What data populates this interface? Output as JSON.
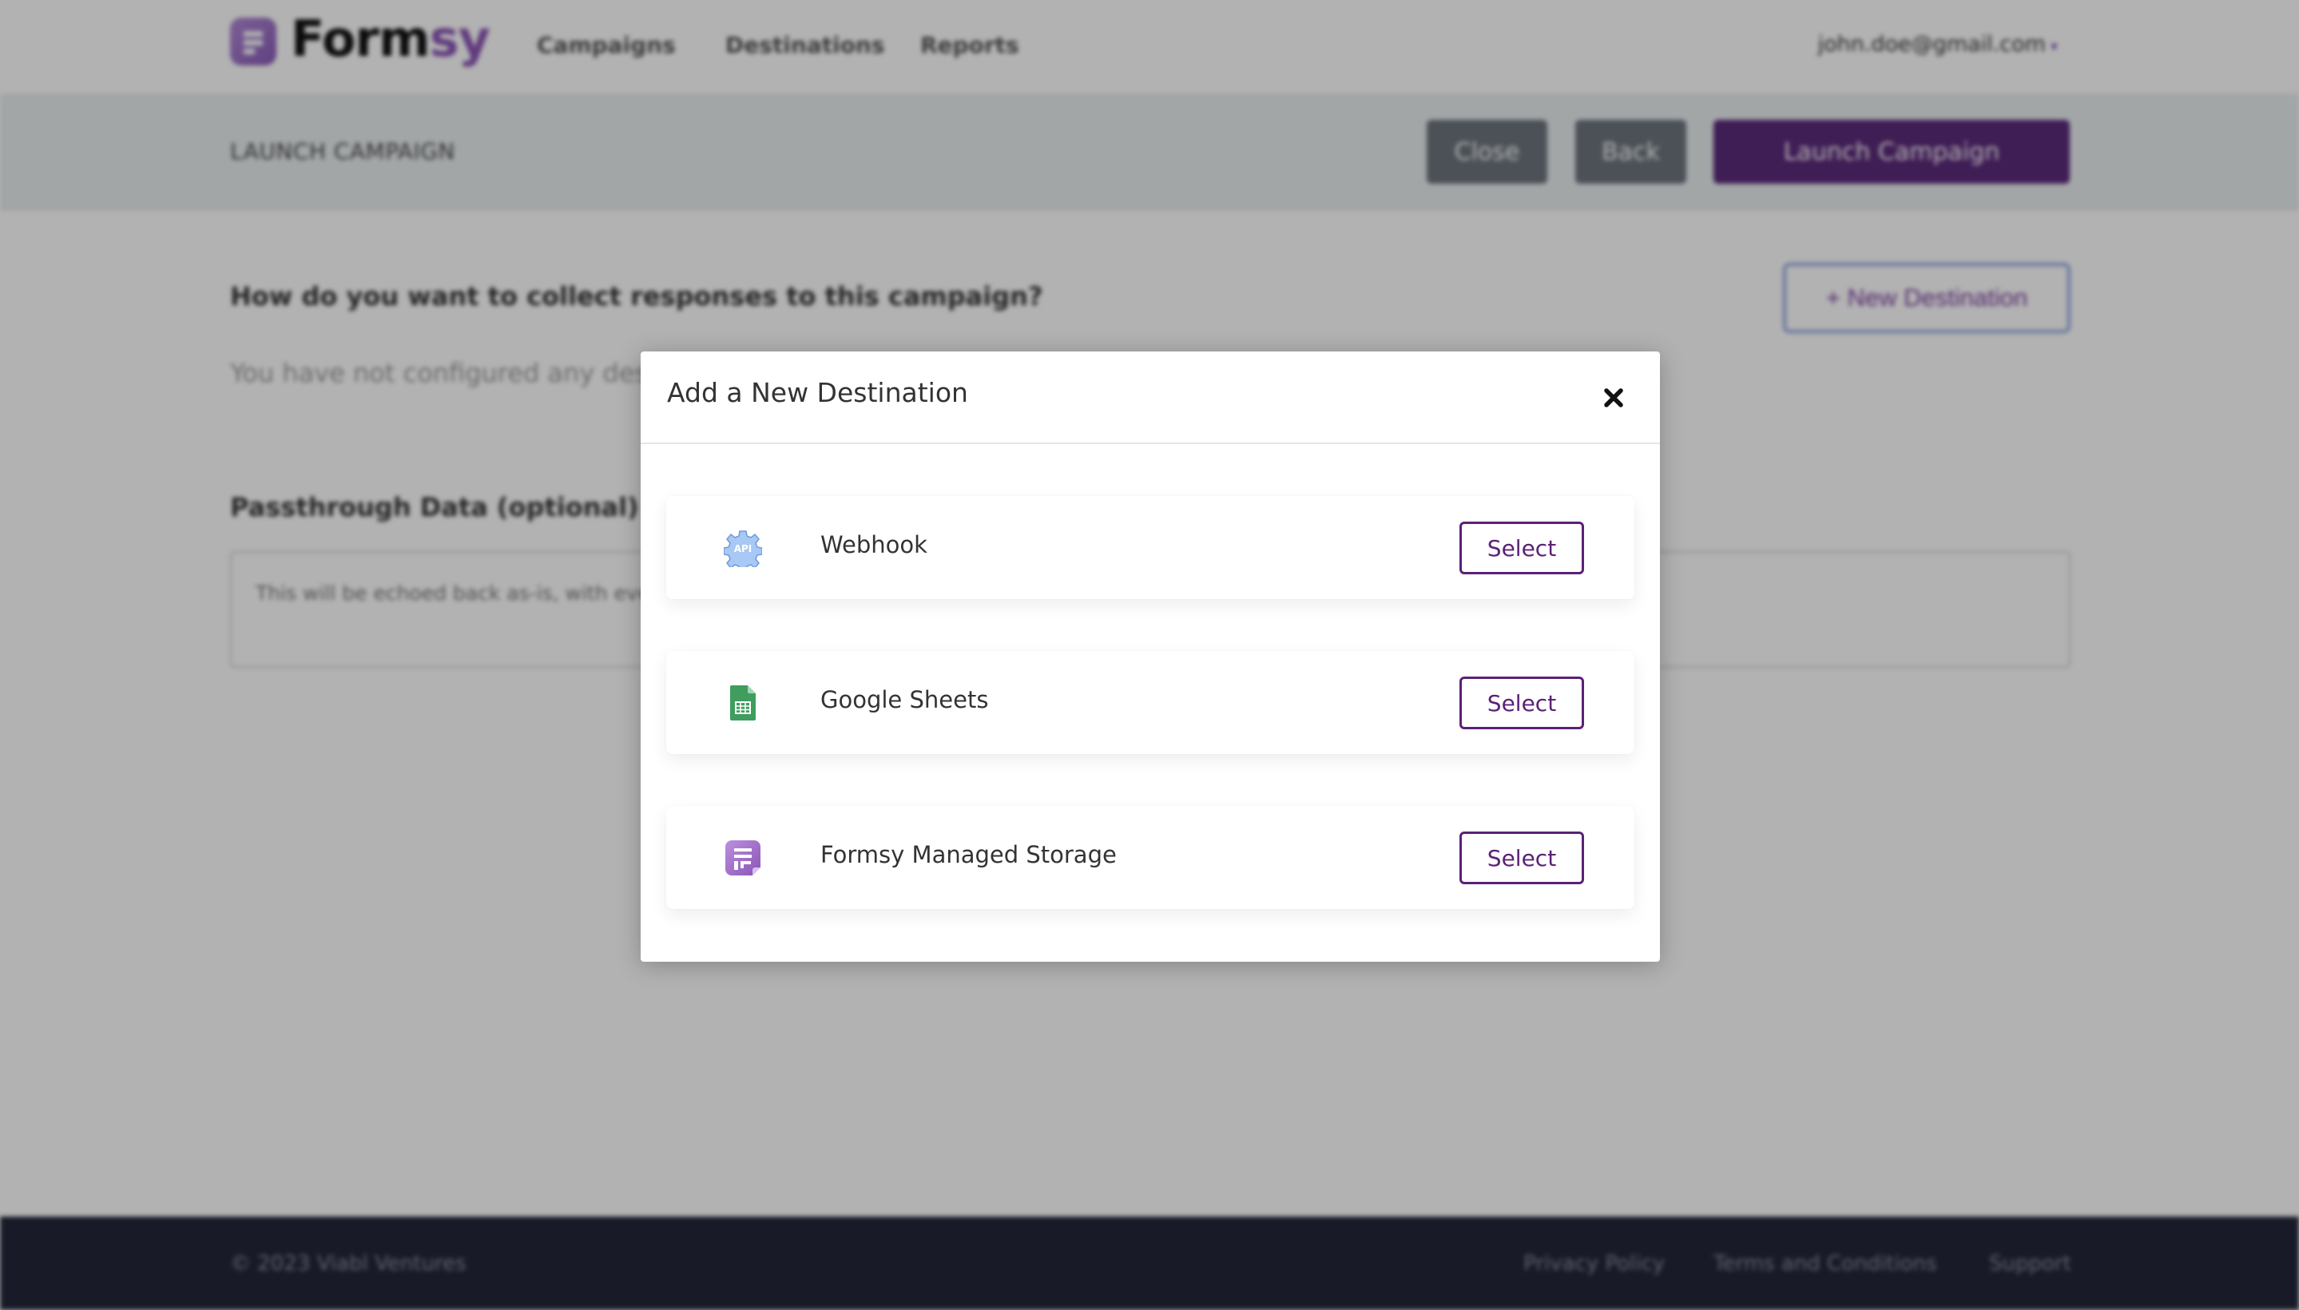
{
  "app": {
    "brand_main": "Form",
    "brand_accent": "sy",
    "brand_color": "#8b55b6"
  },
  "nav": {
    "items": [
      {
        "label": "Campaigns"
      },
      {
        "label": "Destinations"
      },
      {
        "label": "Reports"
      }
    ],
    "user_email": "john.doe@gmail.com",
    "user_caret": "▾"
  },
  "subbar": {
    "title": "LAUNCH CAMPAIGN",
    "close_label": "Close",
    "back_label": "Back",
    "launch_label": "Launch Campaign"
  },
  "main": {
    "question": "How do you want to collect responses to this campaign?",
    "new_destination_label": "+ New Destination",
    "empty_note": "You have not configured any destinations yet.",
    "passthrough_label": "Passthrough Data (optional)",
    "passthrough_placeholder": "This will be echoed back as-is, with every response."
  },
  "footer": {
    "copyright": "© 2023 Viabl Ventures",
    "links": [
      {
        "label": "Privacy Policy"
      },
      {
        "label": "Terms and Conditions"
      },
      {
        "label": "Support"
      }
    ]
  },
  "modal": {
    "title": "Add a New Destination",
    "close_icon": "close-icon",
    "destinations": [
      {
        "name": "Webhook",
        "icon": "api-gear-icon",
        "select_label": "Select"
      },
      {
        "name": "Google Sheets",
        "icon": "google-sheets-icon",
        "select_label": "Select"
      },
      {
        "name": "Formsy Managed Storage",
        "icon": "formsy-icon",
        "select_label": "Select"
      }
    ]
  }
}
